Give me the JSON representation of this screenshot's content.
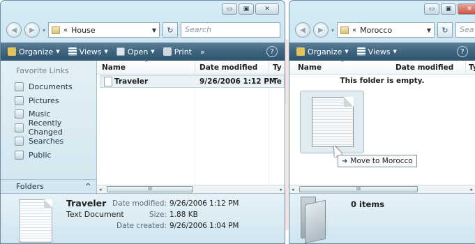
{
  "colors": {
    "accent": "#3e6580",
    "selection": "#e8f1f6",
    "watermark": "#c0392b"
  },
  "left": {
    "caption": {
      "minimize": "▭",
      "maximize": "▣",
      "close": "✕"
    },
    "address": {
      "chevrons": "«",
      "path": "House",
      "search_placeholder": "Search"
    },
    "toolbar": {
      "organize": "Organize",
      "views": "Views",
      "open": "Open",
      "print": "Print",
      "more": "»",
      "help": "?"
    },
    "nav": {
      "title": "Favorite Links",
      "items": [
        {
          "label": "Documents",
          "icon": "documents-icon"
        },
        {
          "label": "Pictures",
          "icon": "pictures-icon"
        },
        {
          "label": "Music",
          "icon": "music-icon"
        },
        {
          "label": "Recently Changed",
          "icon": "recently-changed-icon"
        },
        {
          "label": "Searches",
          "icon": "searches-icon"
        },
        {
          "label": "Public",
          "icon": "public-icon"
        }
      ],
      "folders_label": "Folders",
      "folders_chevron": "^"
    },
    "columns": {
      "name": "Name",
      "date": "Date modified",
      "type": "Ty"
    },
    "files": [
      {
        "name": "Traveler",
        "date": "9/26/2006 1:12 PM",
        "type": "Te"
      }
    ],
    "scroll": {
      "left": "◂",
      "right": "▸",
      "thumb": "III"
    },
    "details": {
      "name": "Traveler",
      "type": "Text Document",
      "date_modified_label": "Date modified:",
      "date_modified": "9/26/2006 1:12 PM",
      "size_label": "Size:",
      "size": "1.88 KB",
      "date_created_label": "Date created:",
      "date_created": "9/26/2006 1:04 PM"
    }
  },
  "right": {
    "caption": {
      "minimize": "▭",
      "maximize": "▣",
      "close": "✕"
    },
    "address": {
      "chevrons": "«",
      "path": "Morocco",
      "search_placeholder": "Sea"
    },
    "toolbar": {
      "organize": "Organize",
      "views": "Views",
      "help": "?"
    },
    "columns": {
      "name": "Name",
      "date": "Date modified",
      "type": "Ty"
    },
    "empty_message": "This folder is empty.",
    "scroll": {
      "left": "◂",
      "right": "▸",
      "thumb": "III"
    },
    "details": {
      "count": "0 items"
    }
  },
  "drag": {
    "tooltip_arrow": "➜",
    "tooltip": "Move to Morocco"
  }
}
